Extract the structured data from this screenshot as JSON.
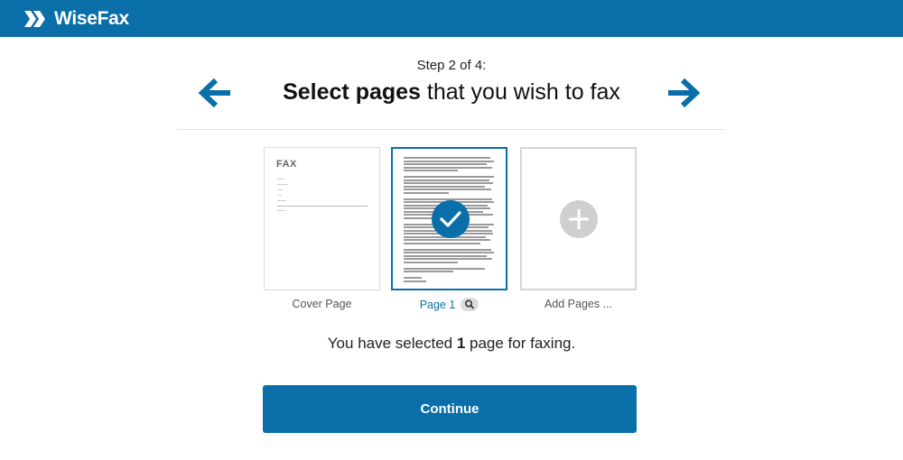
{
  "header": {
    "logo_text": "WiseFax",
    "logo_icon": "double-chevron-logo-icon",
    "background_color": "#0a6ea8"
  },
  "wizard": {
    "step_label": "Step 2 of 4:",
    "headline_bold": "Select pages",
    "headline_rest": " that you wish to fax",
    "prev_icon": "arrow-left-icon",
    "next_icon": "arrow-right-icon"
  },
  "pages": [
    {
      "id": "cover",
      "caption": "Cover Page",
      "selected": false,
      "thumbnail_title": "FAX"
    },
    {
      "id": "page1",
      "caption": "Page 1",
      "selected": true,
      "zoom_icon": "magnifier-icon"
    },
    {
      "id": "add",
      "caption": "Add Pages ...",
      "selected": false,
      "icon": "plus-icon"
    }
  ],
  "selection": {
    "prefix": "You have selected ",
    "count": "1",
    "suffix": " page for faxing."
  },
  "actions": {
    "continue_label": "Continue"
  }
}
